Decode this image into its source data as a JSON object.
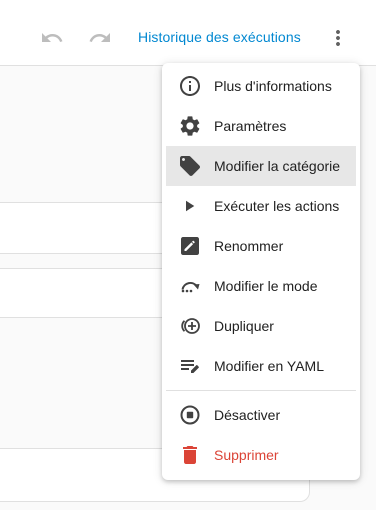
{
  "header": {
    "undo_icon": "undo-icon",
    "redo_icon": "redo-icon",
    "history_label": "Historique des exécutions",
    "more_icon": "more-vertical-icon"
  },
  "menu": {
    "items": [
      {
        "label": "Plus d'informations",
        "icon": "info-icon"
      },
      {
        "label": "Paramètres",
        "icon": "gear-icon"
      },
      {
        "label": "Modifier la catégorie",
        "icon": "tag-icon"
      },
      {
        "label": "Exécuter les actions",
        "icon": "play-icon"
      },
      {
        "label": "Renommer",
        "icon": "rename-icon"
      },
      {
        "label": "Modifier le mode",
        "icon": "mode-icon"
      },
      {
        "label": "Dupliquer",
        "icon": "duplicate-icon"
      },
      {
        "label": "Modifier en YAML",
        "icon": "yaml-edit-icon"
      }
    ],
    "secondary_items": [
      {
        "label": "Désactiver",
        "icon": "stop-icon"
      },
      {
        "label": "Supprimer",
        "icon": "delete-icon"
      }
    ]
  },
  "colors": {
    "accent": "#0288d1",
    "danger": "#db4437",
    "icon": "#424242",
    "disabled_icon": "#bdbdbd",
    "highlight": "#e7e7e7"
  }
}
